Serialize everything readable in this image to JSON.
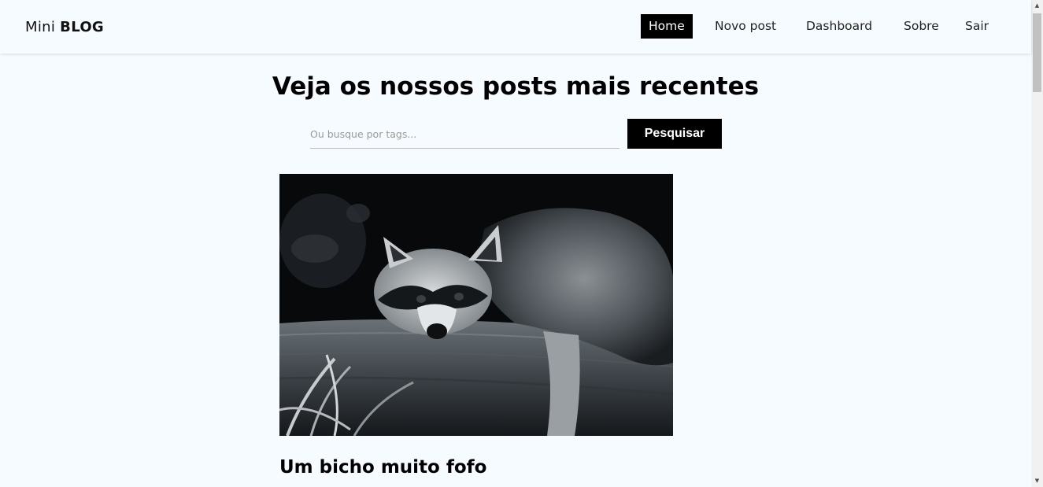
{
  "brand": {
    "light": "Mini",
    "bold": "BLOG"
  },
  "nav": {
    "items": [
      {
        "label": "Home",
        "active": true
      },
      {
        "label": "Novo post",
        "active": false
      },
      {
        "label": "Dashboard",
        "active": false
      },
      {
        "label": "Sobre",
        "active": false
      },
      {
        "label": "Sair",
        "active": false
      }
    ]
  },
  "main": {
    "title": "Veja os nossos posts mais recentes",
    "search": {
      "placeholder": "Ou busque por tags...",
      "button_label": "Pesquisar"
    },
    "posts": [
      {
        "title": "Um bicho muito fofo",
        "image": "raccoon-photo"
      }
    ]
  },
  "colors": {
    "background": "#f6fbff",
    "active_nav_bg": "#000000",
    "button_bg": "#000000"
  }
}
